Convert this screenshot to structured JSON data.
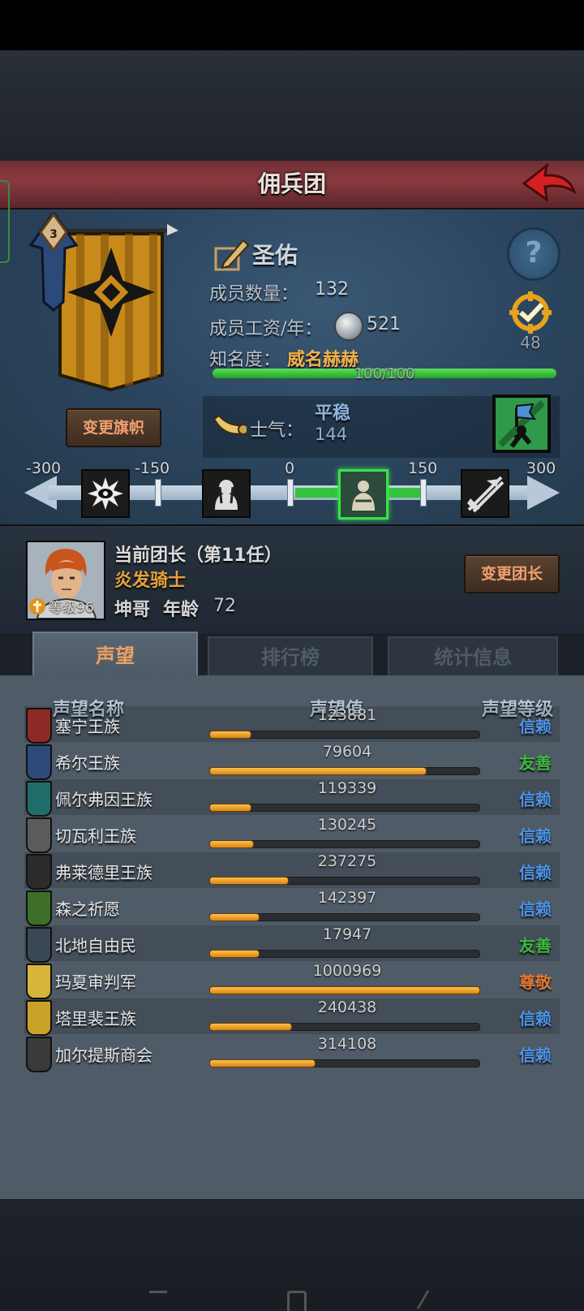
{
  "title": "佣兵团",
  "colors": {
    "accent_orange": "#f3a070",
    "fame_green": "#32c23c",
    "rank_trust": "#4f93e6",
    "rank_friendly": "#3fb83f",
    "rank_respect": "#e07832",
    "bar_orange": "#f0a020"
  },
  "troop": {
    "banner_button": "变更旗帜",
    "banner_level": "3",
    "name": "圣佑",
    "members_label": "成员数量：",
    "members_value": "132",
    "wage_label": "成员工资/年：",
    "wage_value": "521",
    "fame_label": "知名度：",
    "fame_value": "威名赫赫",
    "fame_progress": "100/100",
    "fame_fraction": 1.0,
    "target_value": "48",
    "morale_label": "士气：",
    "morale_state": "平稳",
    "morale_value": "144",
    "morale_scale": {
      "ticks": [
        "-300",
        "-150",
        "0",
        "150",
        "300"
      ],
      "current": 144
    }
  },
  "leader": {
    "title": "当前团长（第11任）",
    "class": "炎发骑士",
    "name": "坤哥",
    "age_label": "年龄",
    "age": "72",
    "level_label": "等级96",
    "change_button": "变更团长"
  },
  "tabs": [
    {
      "label": "声望",
      "active": true
    },
    {
      "label": "排行榜",
      "active": false
    },
    {
      "label": "统计信息",
      "active": false
    }
  ],
  "columns": {
    "name": "声望名称",
    "value": "声望值",
    "rank": "声望等级"
  },
  "factions": [
    {
      "name": "塞宁王族",
      "value": "123881",
      "fill": 0.15,
      "rank": "信赖",
      "rank_type": "trust",
      "crest_color": "#8e2a26"
    },
    {
      "name": "希尔王族",
      "value": "79604",
      "fill": 0.8,
      "rank": "友善",
      "rank_type": "friendly",
      "crest_color": "#2c4a7a"
    },
    {
      "name": "佩尔弗因王族",
      "value": "119339",
      "fill": 0.15,
      "rank": "信赖",
      "rank_type": "trust",
      "crest_color": "#1f6d6b"
    },
    {
      "name": "切瓦利王族",
      "value": "130245",
      "fill": 0.16,
      "rank": "信赖",
      "rank_type": "trust",
      "crest_color": "#5b5b5b"
    },
    {
      "name": "弗莱德里王族",
      "value": "237275",
      "fill": 0.29,
      "rank": "信赖",
      "rank_type": "trust",
      "crest_color": "#2b2b2b"
    },
    {
      "name": "森之祈愿",
      "value": "142397",
      "fill": 0.18,
      "rank": "信赖",
      "rank_type": "trust",
      "crest_color": "#3d6e2a"
    },
    {
      "name": "北地自由民",
      "value": "17947",
      "fill": 0.18,
      "rank": "友善",
      "rank_type": "friendly",
      "crest_color": "#3a4756"
    },
    {
      "name": "玛夏审判军",
      "value": "1000969",
      "fill": 1.0,
      "rank": "尊敬",
      "rank_type": "respect",
      "crest_color": "#d7b43a"
    },
    {
      "name": "塔里裴王族",
      "value": "240438",
      "fill": 0.3,
      "rank": "信赖",
      "rank_type": "trust",
      "crest_color": "#c9a22a"
    },
    {
      "name": "加尔提斯商会",
      "value": "314108",
      "fill": 0.39,
      "rank": "信赖",
      "rank_type": "trust",
      "crest_color": "#3a3a3a"
    }
  ]
}
